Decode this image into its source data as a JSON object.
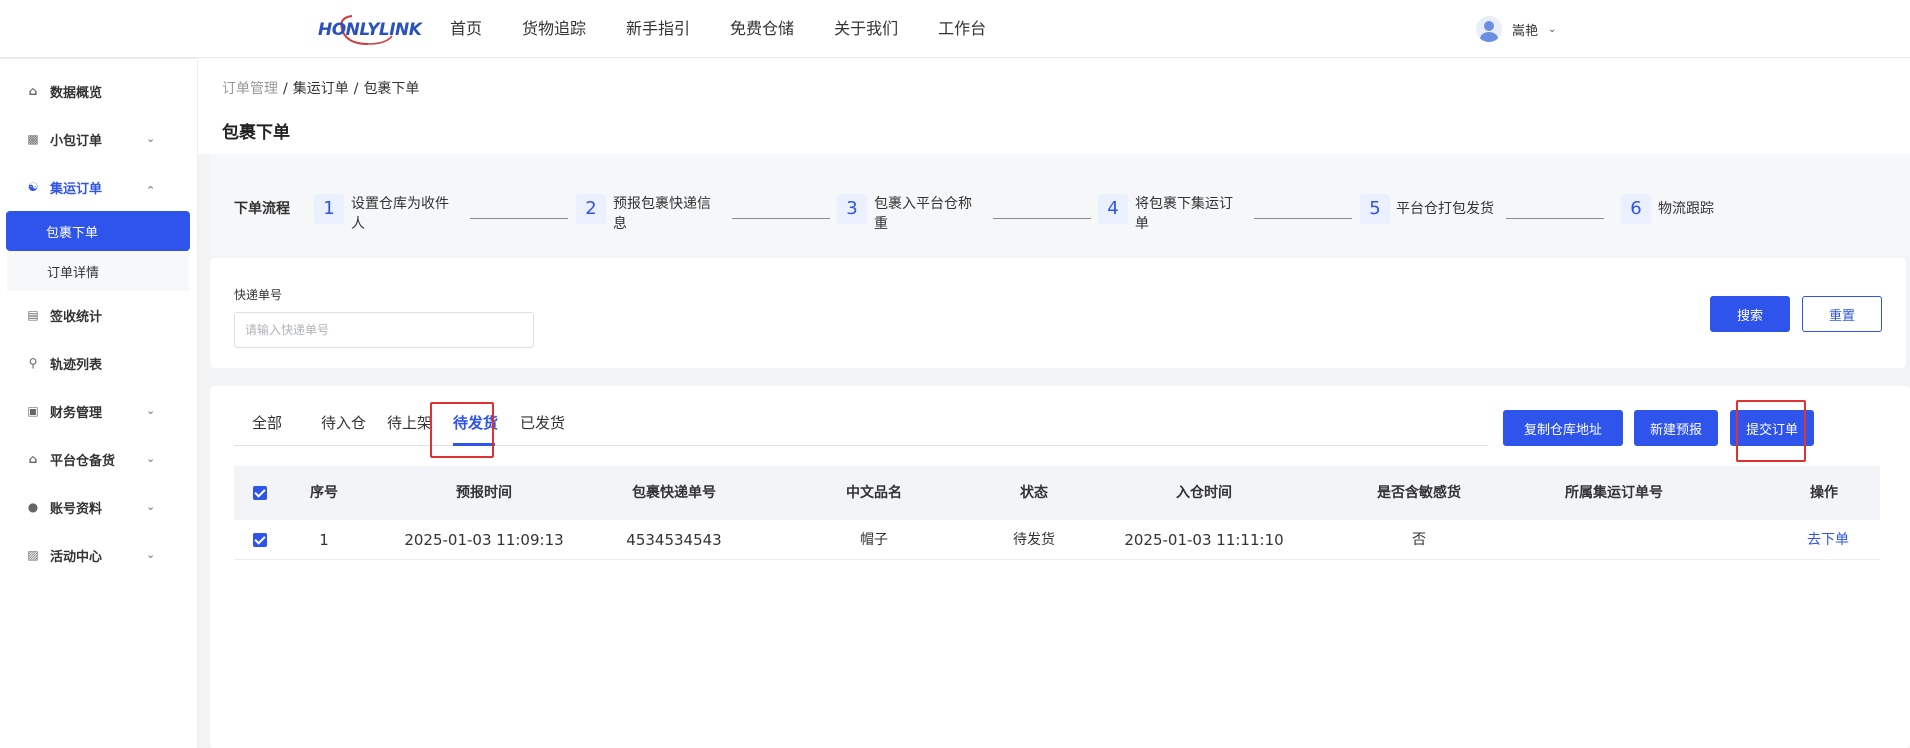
{
  "brand": {
    "logo_text": "HONLYLINK",
    "accent": "#2f54eb",
    "logo_accent": "#d33a3a"
  },
  "nav": {
    "items": [
      "首页",
      "货物追踪",
      "新手指引",
      "免费仓储",
      "关于我们",
      "工作台"
    ]
  },
  "user": {
    "name": "嵩艳",
    "avatar_icon": "user-avatar-icon",
    "caret_icon": "chevron-down-icon"
  },
  "sidebar": {
    "items": [
      {
        "label": "数据概览",
        "icon": "home-icon"
      },
      {
        "label": "小包订单",
        "icon": "package-icon"
      },
      {
        "label": "集运订单",
        "icon": "consolidation-icon"
      },
      {
        "label": "签收统计",
        "icon": "clipboard-icon"
      },
      {
        "label": "轨迹列表",
        "icon": "location-icon"
      },
      {
        "label": "财务管理",
        "icon": "wallet-icon"
      },
      {
        "label": "平台仓备货",
        "icon": "warehouse-icon"
      },
      {
        "label": "账号资料",
        "icon": "user-icon"
      },
      {
        "label": "活动中心",
        "icon": "gift-icon"
      }
    ],
    "sub_items": [
      "包裹下单",
      "订单详情"
    ]
  },
  "breadcrumb": {
    "items": [
      "订单管理",
      "集运订单",
      "包裹下单"
    ],
    "sep": "/"
  },
  "page": {
    "title": "包裹下单"
  },
  "flow": {
    "label": "下单流程",
    "steps": [
      {
        "num": "1",
        "text": "设置仓库为收件人"
      },
      {
        "num": "2",
        "text": "预报包裹快递信息"
      },
      {
        "num": "3",
        "text": "包裹入平台仓称重"
      },
      {
        "num": "4",
        "text": "将包裹下集运订单"
      },
      {
        "num": "5",
        "text": "平台仓打包发货"
      },
      {
        "num": "6",
        "text": "物流跟踪"
      }
    ]
  },
  "search": {
    "label": "快递单号",
    "placeholder": "请输入快递单号",
    "value": "",
    "search_btn": "搜索",
    "reset_btn": "重置"
  },
  "tabs": {
    "items": [
      "全部",
      "待入仓",
      "待上架",
      "待发货",
      "已发货"
    ],
    "active_index": 3
  },
  "actions": {
    "copy": "复制仓库地址",
    "new": "新建预报",
    "submit": "提交订单"
  },
  "table": {
    "columns": [
      "序号",
      "预报时间",
      "包裹快递单号",
      "中文品名",
      "状态",
      "入仓时间",
      "是否含敏感货",
      "所属集运订单号",
      "操作"
    ],
    "rows": [
      {
        "index": "1",
        "forecast_time": "2025-01-03 11:09:13",
        "tracking_no": "4534534543",
        "name_cn": "帽子",
        "status": "待发货",
        "in_time": "2025-01-03 11:11:10",
        "sensitive": "否",
        "order_no": "",
        "action": "去下单",
        "checked": true
      }
    ],
    "header_checked": true
  },
  "highlight": {
    "color": "#e0322f"
  }
}
